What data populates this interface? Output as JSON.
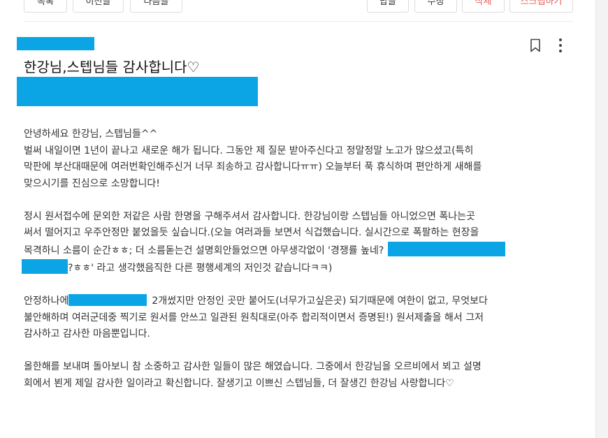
{
  "toolbar": {
    "list_label": "목록",
    "prev_label": "이전글",
    "next_label": "다음글",
    "reply_label": "답글",
    "edit_label": "수정",
    "delete_label": "삭제",
    "scrap_label": "스크랩하기"
  },
  "post": {
    "title": "한강님,스텝님들 감사합니다♡",
    "paragraph1": [
      "안녕하세요 한강님, 스텝님들^^",
      "벌써 내일이면 1년이 끝나고 새로운 해가 됩니다. 그동안 제 질문 받아주신다고 정말정말 노고가 많으셨고(특히",
      "막판에 부산대때문에 여러번확인해주신거 너무 죄송하고 감사합니다ㅠㅠ) 오늘부터 푹 휴식하며 편안하게 새해를",
      "맞으시기를 진심으로 소망합니다!"
    ],
    "paragraph2": [
      "정시 원서접수에 문외한 저같은 사람 한명을 구해주셔서 감사합니다. 한강님이랑 스텝님들 아니었으면 폭나는곳",
      "써서 떨어지고 우주안정만 붙었을듯 싶습니다.(오늘 여러과들 보면서 식겁했습니다. 실시간으로 폭팔하는 현장을",
      "목격하니 소름이 순간ㅎㅎ; 더 소름돋는건 설명회안들었으면 아무생각없이 '경쟁률 높네?",
      "?ㅎㅎ' 라고 생각했음직한 다른 평행세계의 저인것 같습니다ㅋㅋ)"
    ],
    "paragraph3": [
      "안정하나에",
      "2개썼지만 안정인 곳만 붙어도(너무가고싶은곳) 되기때문에 여한이 없고, 무엇보다",
      "불안해하며 여러군데중 찍기로 원서를 안쓰고 일관된 원칙대로(아주 합리적이면서 증명된!) 원서제출을 해서 그저",
      "감사하고 감사한 마음뿐입니다."
    ],
    "paragraph4": [
      "올한해를 보내며 돌아보니 참 소중하고 감사한 일들이 많은 해였습니다. 그중에서 한강님을 오르비에서 뵈고 설명",
      "회에서 뵌게 제일 감사한 일이라고 확신합니다. 잘생기고 이쁘신 스텝님들, 더 잘생긴 한강님 사랑합니다♡"
    ]
  },
  "icons": {
    "bookmark": "bookmark-icon",
    "more": "more-vertical-icon"
  },
  "colors": {
    "redaction": "#0ba5e6",
    "danger": "#e85a5a"
  }
}
